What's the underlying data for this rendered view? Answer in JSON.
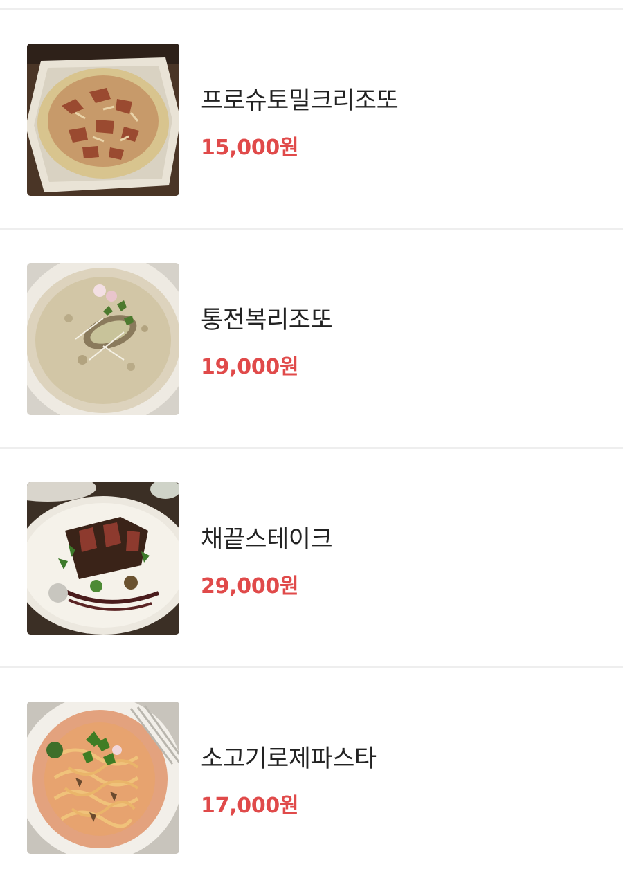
{
  "menu": {
    "items": [
      {
        "name": "프로슈토밀크리조또",
        "price": "15,000원",
        "photo": "risotto-prosciutto-photo"
      },
      {
        "name": "통전복리조또",
        "price": "19,000원",
        "photo": "risotto-abalone-photo"
      },
      {
        "name": "채끝스테이크",
        "price": "29,000원",
        "photo": "sirloin-steak-photo"
      },
      {
        "name": "소고기로제파스타",
        "price": "17,000원",
        "photo": "beef-rose-pasta-photo"
      }
    ]
  },
  "colors": {
    "price": "#e04a4a",
    "name": "#222222",
    "divider": "#eeeeee",
    "background": "#ffffff"
  }
}
